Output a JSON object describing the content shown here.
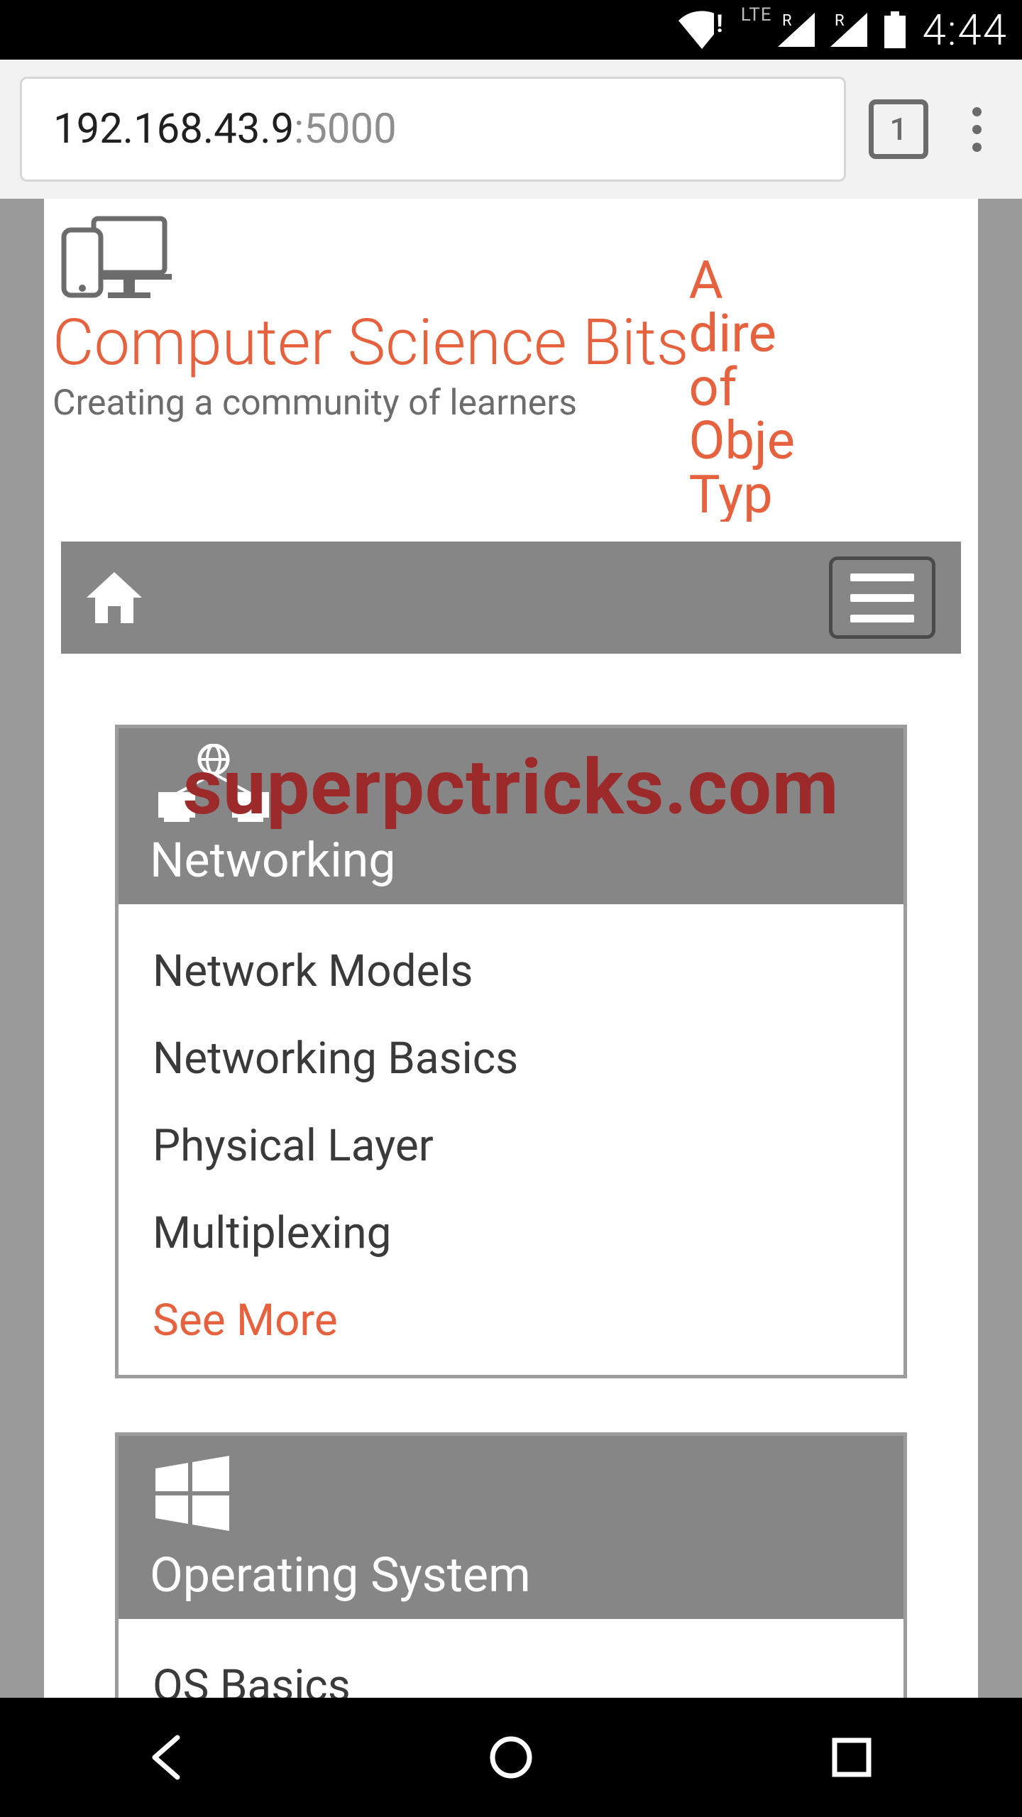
{
  "status": {
    "lte": "LTE",
    "clock": "4:44"
  },
  "chrome": {
    "url_host": "192.168.43.9",
    "url_port": ":5000",
    "tab_count": "1"
  },
  "site": {
    "brand_title": "Computer Science Bits",
    "brand_tag": "Creating a community of learners",
    "side_text": "A\ndire\nof\nObje\nTyp"
  },
  "watermark": "superpctricks.com",
  "cards": [
    {
      "title": "Networking",
      "links": [
        "Network Models",
        "Networking Basics",
        "Physical Layer",
        "Multiplexing"
      ],
      "see_more": "See More"
    },
    {
      "title": "Operating System",
      "links": [
        "OS Basics"
      ]
    }
  ]
}
